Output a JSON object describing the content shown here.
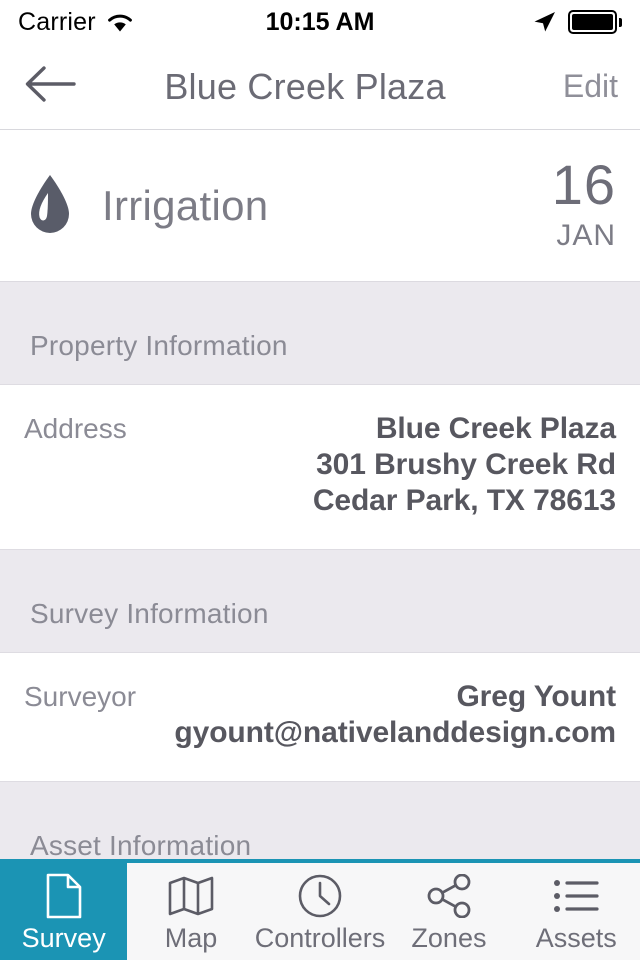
{
  "status_bar": {
    "carrier": "Carrier",
    "time": "10:15 AM",
    "wifi_icon": "wifi-icon",
    "location_icon": "location-arrow-icon",
    "battery_icon": "battery-full-icon"
  },
  "nav": {
    "back_icon": "back-arrow-icon",
    "title": "Blue Creek Plaza",
    "edit_label": "Edit"
  },
  "survey_header": {
    "icon": "water-droplet-icon",
    "title": "Irrigation",
    "day": "16",
    "month": "JAN"
  },
  "sections": [
    {
      "heading": "Property Information",
      "rows": [
        {
          "label": "Address",
          "values": [
            "Blue Creek Plaza",
            "301 Brushy Creek Rd",
            "Cedar Park, TX 78613"
          ]
        }
      ]
    },
    {
      "heading": "Survey Information",
      "rows": [
        {
          "label": "Surveyor",
          "values": [
            "Greg Yount",
            "gyount@nativelanddesign.com"
          ]
        }
      ]
    },
    {
      "heading": "Asset Information",
      "rows": []
    }
  ],
  "tabs": [
    {
      "label": "Survey",
      "icon": "document-icon",
      "active": true
    },
    {
      "label": "Map",
      "icon": "map-icon",
      "active": false
    },
    {
      "label": "Controllers",
      "icon": "clock-icon",
      "active": false
    },
    {
      "label": "Zones",
      "icon": "share-nodes-icon",
      "active": false
    },
    {
      "label": "Assets",
      "icon": "list-icon",
      "active": false
    }
  ],
  "colors": {
    "accent": "#1b94b4",
    "page_background": "#ebe9ee",
    "text_primary": "#57575f",
    "text_muted": "#8b8b95",
    "droplet": "#595c69"
  }
}
